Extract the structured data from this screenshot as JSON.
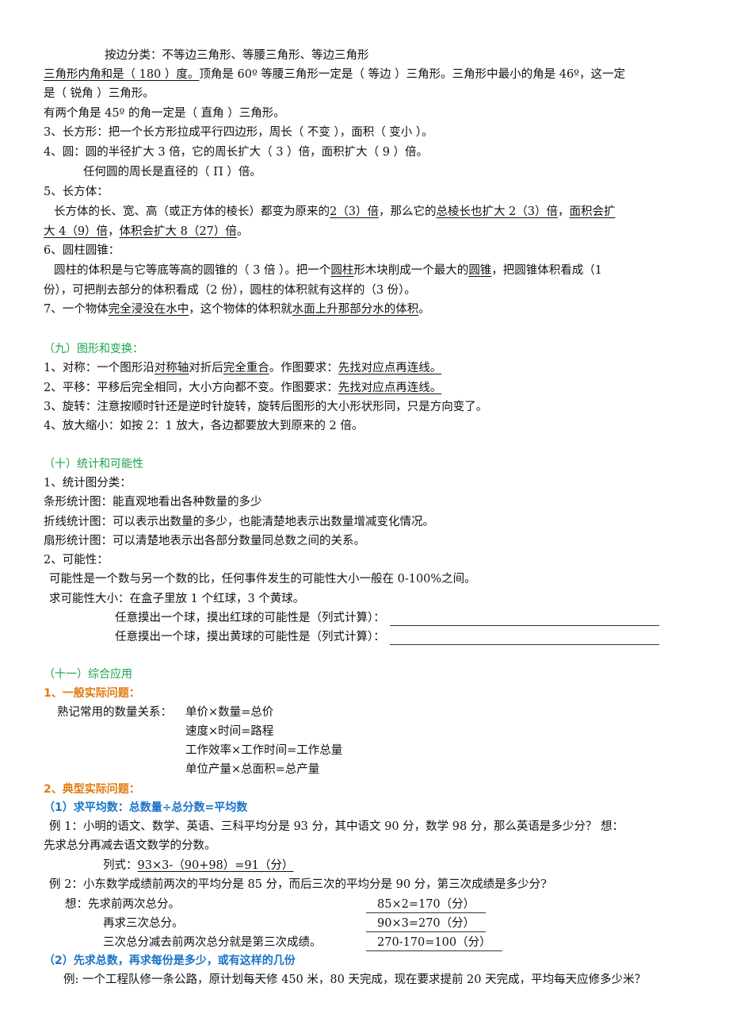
{
  "triangles": {
    "by_side": "按边分类：不等边三角形、等腰三角形、等边三角形",
    "line2_u": "三角形内角和是（ 180 ）度。",
    "line2_rest": "顶角是 60º 等腰三角形一定是（  等边  ）三角形。三角形中最小的角是 46º，这一定",
    "line3": "是（ 锐角 ）三角形。",
    "line4": "有两个角是 45º 的角一定是（  直角  ）三角形。"
  },
  "rect": "3、长方形：把一个长方形拉成平行四边形，周长（ 不变 ），面积（  变小  ）。",
  "circle": {
    "line1": "4、圆：圆的半径扩大 3 倍，它的周长扩大（  3  ）倍，面积扩大（  9  ）倍。",
    "line2": "任何圆的周长是直径的（  Π  ）倍。"
  },
  "cuboid": {
    "title": "5、长方体：",
    "p1": "长方体的长、宽、高（或正方体的棱长）都变为原来的",
    "u1": "2（3）倍",
    "p2": "，那么它的",
    "u2": "总棱长也扩大 2（3）倍",
    "p3": "，",
    "u3": "面积会扩",
    "u4": "大 4（9）倍",
    "p4": "，",
    "u5": "体积会扩大 8（27）倍",
    "p5": "。"
  },
  "cylinder": {
    "title": "6、圆柱圆锥：",
    "p1": "圆柱的体积是与它等底等高的圆锥的（  3 倍  ）。把一个",
    "u1": "圆柱",
    "p2": "形木块削成一个最大的",
    "u2": "圆锥",
    "p3": "，把圆锥体积看成（1",
    "line2": "份），可把削去部分的体积看成（2 份），圆柱的体积就有这样的（3 份）。"
  },
  "object": {
    "p1": "7、一个物体",
    "u1": "完全浸没在水中",
    "p2": "，这个物体的体积就",
    "u2": "水面上升那部分水的体积",
    "p3": "。"
  },
  "section9": {
    "title": "（九）图形和变换：",
    "item1_a": "1、对称：一个图形沿",
    "item1_u1": "对称轴",
    "item1_b": "对折后",
    "item1_u2": "完全重合",
    "item1_c": "。作图要求：",
    "item1_u3": "先找对应点再连线。 ",
    "item2_a": "2、平移：平移后完全相同，大小方向都不变。作图要求：",
    "item2_u": "先找对应点再连线。 ",
    "item3": "3、旋转：注意按顺时针还是逆时针旋转，旋转后图形的大小形状形同，只是方向变了。",
    "item4": "4、放大缩小：如按 2：1 放大，各边都要放大到原来的 2 倍。"
  },
  "section10": {
    "title": "（十）统计和可能性",
    "item1": "1、统计图分类：",
    "bar": "条形统计图：能直观地看出各种数量的多少",
    "line": "折线统计图：可以表示出数量的多少，也能清楚地表示出数量增减变化情况。",
    "pie": "扇形统计图：可以清楚地表示出各部分数量同总数之间的关系。",
    "item2": "2、可能性：",
    "def": "可能性是一个数与另一个数的比，任何事件发生的可能性大小一般在 0-100%之间。",
    "ask": "求可能性大小：在盒子里放 1 个红球，3 个黄球。",
    "q1": "任意摸出一个球，摸出红球的可能性是（列式计算）：",
    "q2": "任意摸出一个球，摸出黄球的可能性是（列式计算）："
  },
  "section11": {
    "title": "（十一）综合应用",
    "sub1": "1、一般实际问题：",
    "rel_label": "熟记常用的数量关系：",
    "relations": [
      "单价×数量=总价",
      "速度×时间=路程",
      "工作效率×工作时间=工作总量",
      "单位产量×总面积=总产量"
    ],
    "sub2": "2、典型实际问题：",
    "avg_title": "（1）求平均数：总数量÷总分数=平均数",
    "ex1_line1": "例 1：小明的语文、数学、英语、三科平均分是 93 分，其中语文 90 分，数学 98 分，那么英语是多少分？  想：",
    "ex1_line2": "先求总分再减去语文数学的分数。",
    "ex1_formula_label": "列式：",
    "ex1_formula": "93×3-（90+98）=91（分）",
    "ex2_line1": "例 2：小东数学成绩前两次的平均分是 85 分，而后三次的平均分是 90 分，第三次成绩是多少分?",
    "ex2_steps": [
      {
        "text": "想：先求前两次总分。",
        "calc": "85×2=170（分）"
      },
      {
        "text": "再求三次总分。",
        "calc": "90×3=270（分）"
      },
      {
        "text": "三次总分减去前两次总分就是第三次成绩。",
        "calc": "270-170=100（分）"
      }
    ],
    "total_title": "（2）先求总数，再求每份是多少，或有这样的几份",
    "ex3": "例: 一个工程队修一条公路，原计划每天修 450 米，80 天完成，现在要求提前 20 天完成，平均每天应修多少米？"
  }
}
